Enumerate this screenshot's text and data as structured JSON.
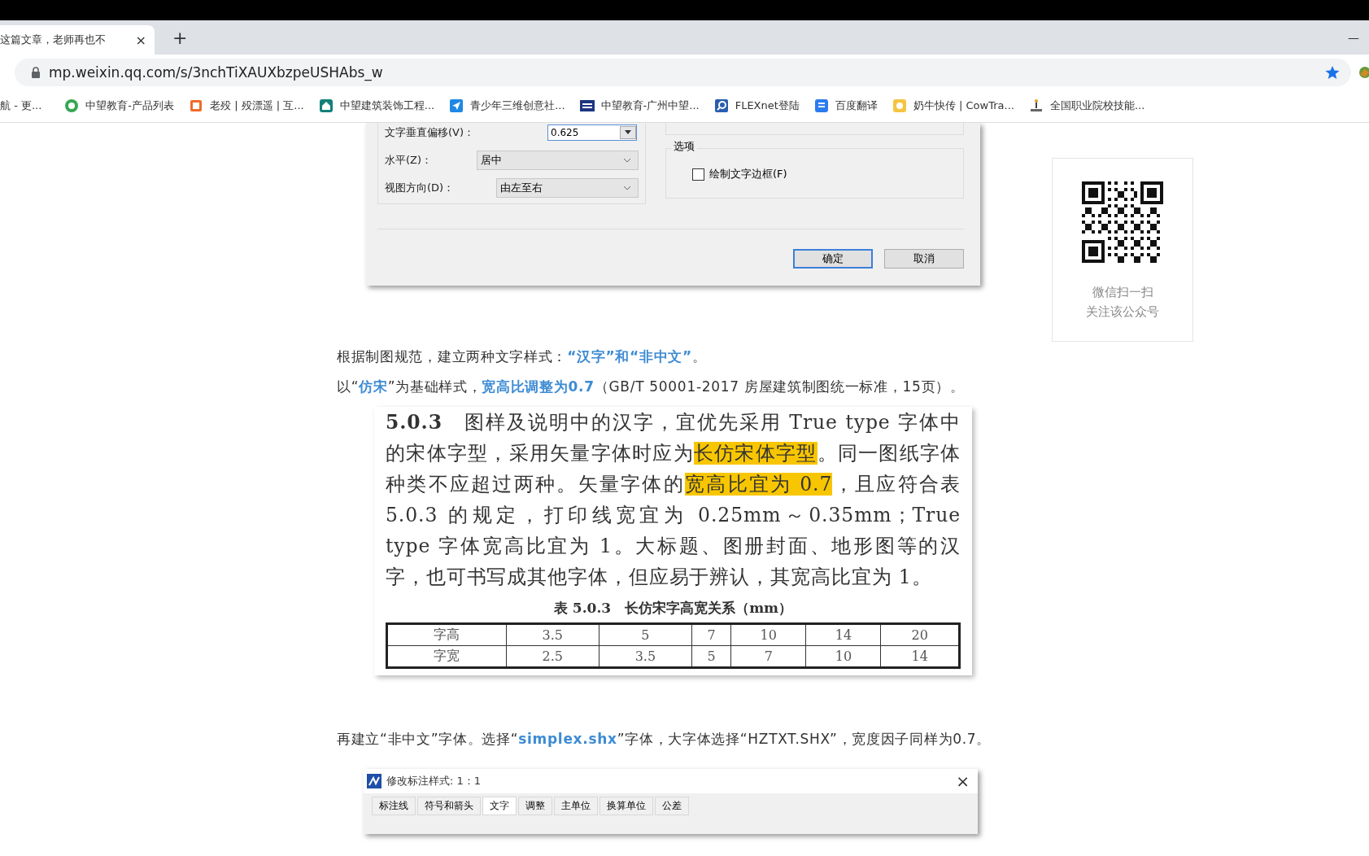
{
  "browser": {
    "tab": {
      "title": "这篇文章，老师再也不",
      "close": "×"
    },
    "new_tab": "+",
    "minimize": "—",
    "address": {
      "url": "mp.weixin.qq.com/s/3nchTiXAUXbzpeUSHAbs_w"
    },
    "bookmarks": [
      {
        "label": "航 - 更..."
      },
      {
        "label": "中望教育-产品列表"
      },
      {
        "label": "老殁 | 殁漂遥 | 互..."
      },
      {
        "label": "中望建筑装饰工程..."
      },
      {
        "label": "青少年三维创意社..."
      },
      {
        "label": "中望教育-广州中望..."
      },
      {
        "label": "FLEXnet登陆"
      },
      {
        "label": "百度翻译"
      },
      {
        "label": "奶牛快传 | CowTra..."
      },
      {
        "label": "全国职业院校技能..."
      }
    ]
  },
  "article": {
    "dialog_top": {
      "offset": {
        "label": "文字垂直偏移(V)：",
        "value": "0.625"
      },
      "rows": [
        {
          "label": "水平(Z)：",
          "value": "居中"
        },
        {
          "label": "视图方向(D)：",
          "value": "由左至右"
        }
      ],
      "options": {
        "title": "选项",
        "checkbox": {
          "label": "绘制文字边框(F)",
          "checked": false
        }
      },
      "buttons": [
        {
          "label": "确定",
          "default": true
        },
        {
          "label": "取消",
          "default": false
        }
      ]
    },
    "paragraphs": [
      "根据制图规范，建立两种文字样式：**“汉字”和“非中文”**。",
      "以“**仿宋**”为基础样式，**宽高比调整为0.7**（GB/T 50001-2017 房屋建筑制图统一标准，15页）。"
    ],
    "excerpt": {
      "segments": [
        {
          "text": "5.0.3",
          "bold": true,
          "highlight": false
        },
        {
          "text": "　图样及说明中的汉字，宜优先采用 True type 字体中的宋体字型，采用矢量字体时应为",
          "bold": false,
          "highlight": false
        },
        {
          "text": "长仿宋体字型",
          "bold": false,
          "highlight": true
        },
        {
          "text": "。同一图纸字体种类不应超过两种。矢量字体的",
          "bold": false,
          "highlight": false
        },
        {
          "text": "宽高比宜为 0.7",
          "bold": false,
          "highlight": true
        },
        {
          "text": "，且应符合表 5.0.3 的规定，打印线宽宜为 0.25mm～0.35mm；True type 字体宽高比宜为 1。大标题、图册封面、地形图等的汉字，也可书写成其他字体，但应易于辨认，其宽高比宜为 1。",
          "bold": false,
          "highlight": false
        }
      ],
      "table_caption": "表 5.0.3　长仿宋字高宽关系（mm）",
      "table": {
        "rows": [
          [
            "字高",
            "3.5",
            "5",
            "7",
            "10",
            "14",
            "20"
          ],
          [
            "字宽",
            "2.5",
            "3.5",
            "5",
            "7",
            "10",
            "14"
          ]
        ]
      }
    },
    "paragraphs_after": [
      "再建立“非中文”字体。选择“**simplex.shx**”字体，大字体选择“HZTXT.SHX”，宽度因子同样为0.7。"
    ],
    "dialog_bottom": {
      "title": "修改标注样式: 1：1",
      "close": "×",
      "tabs": [
        {
          "label": "标注线",
          "selected": false
        },
        {
          "label": "符号和箭头",
          "selected": false
        },
        {
          "label": "文字",
          "selected": true
        },
        {
          "label": "调整",
          "selected": false
        },
        {
          "label": "主单位",
          "selected": false
        },
        {
          "label": "换算单位",
          "selected": false
        },
        {
          "label": "公差",
          "selected": false
        }
      ]
    }
  },
  "sidebar": {
    "qr_caption": [
      "微信扫一扫",
      "关注该公众号"
    ]
  }
}
